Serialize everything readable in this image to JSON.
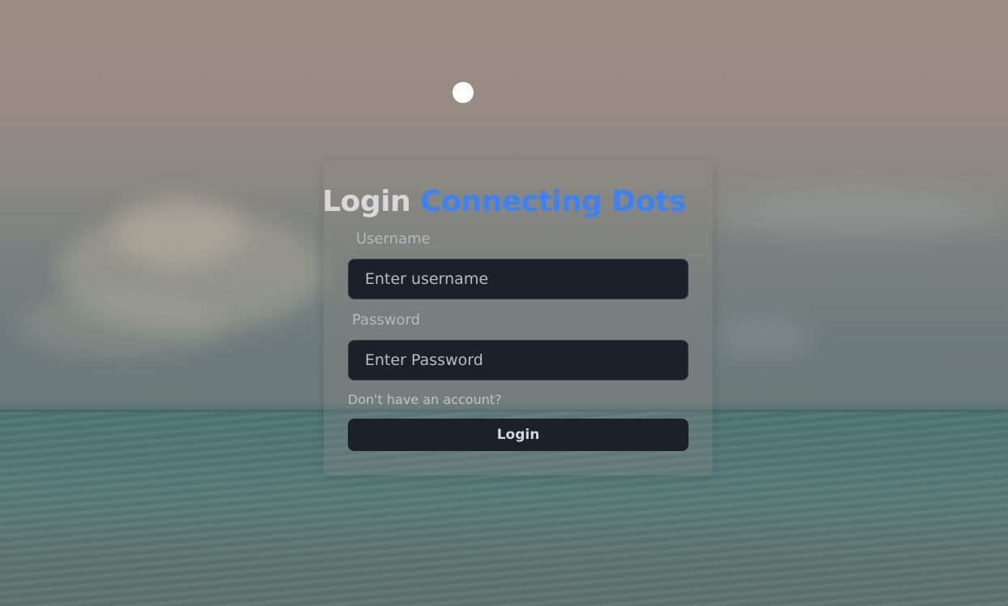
{
  "header": {
    "title_prefix": "Login",
    "title_brand": "Connecting Dots"
  },
  "form": {
    "username_label": "Username",
    "username_placeholder": "Enter username",
    "username_value": "",
    "password_label": "Password",
    "password_placeholder": "Enter Password",
    "password_value": "",
    "signup_prompt": "Don't have an account?",
    "submit_label": "Login"
  },
  "colors": {
    "brand": "#3b82f6",
    "field_bg": "#1c2028",
    "button_bg": "#1c2028"
  }
}
